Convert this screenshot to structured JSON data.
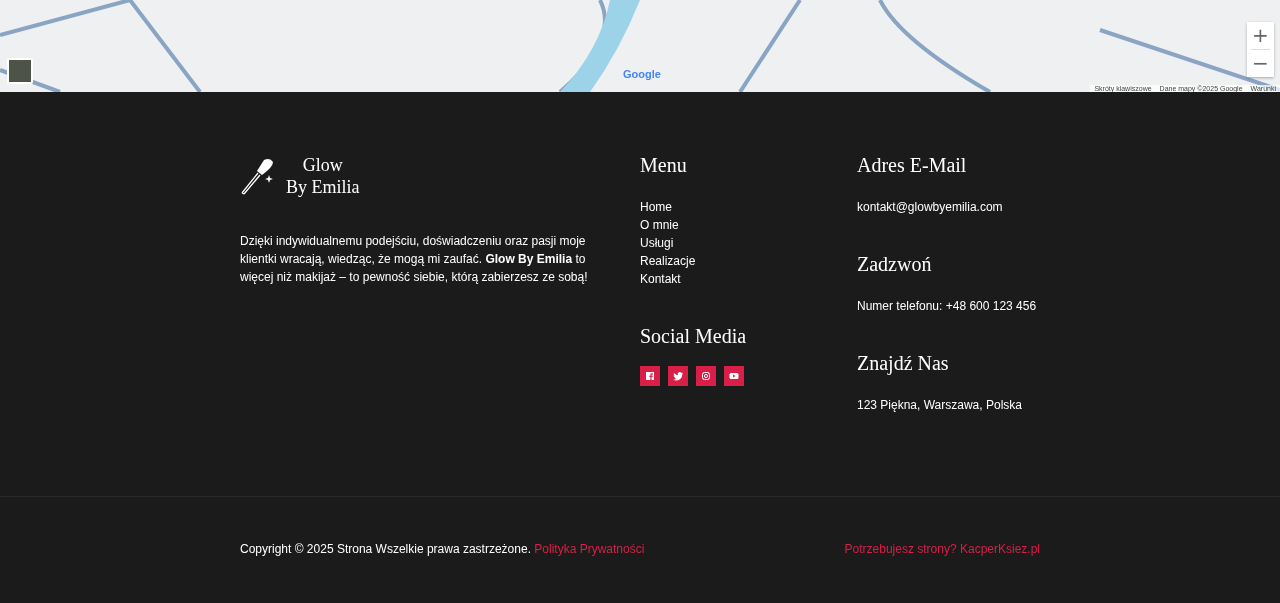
{
  "map": {
    "zoom_in": "+",
    "zoom_out": "−",
    "logo": "Google",
    "attribution": [
      "Skróty klawiszowe",
      "Dane mapy ©2025 Google",
      "Warunki"
    ]
  },
  "brand": {
    "name_line1": "Glow",
    "name_line2": "By Emilia",
    "description": "Dzięki indywidualnemu podejściu, doświadczeniu oraz pasji moje klientki wracają, wiedząc, że mogą mi zaufać. **Glow By Emilia** to więcej niż makijaż – to pewność siebie, którą zabierzesz ze sobą!"
  },
  "menu": {
    "title": "Menu",
    "items": [
      "Home",
      "O mnie",
      "Usługi",
      "Realizacje",
      "Kontakt"
    ]
  },
  "social": {
    "title": "Social Media",
    "icons": [
      {
        "kind": "facebook"
      },
      {
        "kind": "twitter"
      },
      {
        "kind": "instagram"
      },
      {
        "kind": "youtube"
      }
    ]
  },
  "contact": [
    {
      "title": "Adres E-Mail",
      "text": "kontakt@glowbyemilia.com"
    },
    {
      "title": "Zadzwoń",
      "text": "Numer telefonu: +48 600 123 456"
    },
    {
      "title": "Znajdź Nas",
      "text": "123 Piękna, Warszawa, Polska"
    }
  ],
  "bottom": {
    "copyright": "Copyright © 2025 Strona Wszelkie prawa zastrzeżone.",
    "privacy_link": "Polityka Prywatności",
    "credit_link": "Potrzebujesz strony? KacperKsiez.pl"
  }
}
